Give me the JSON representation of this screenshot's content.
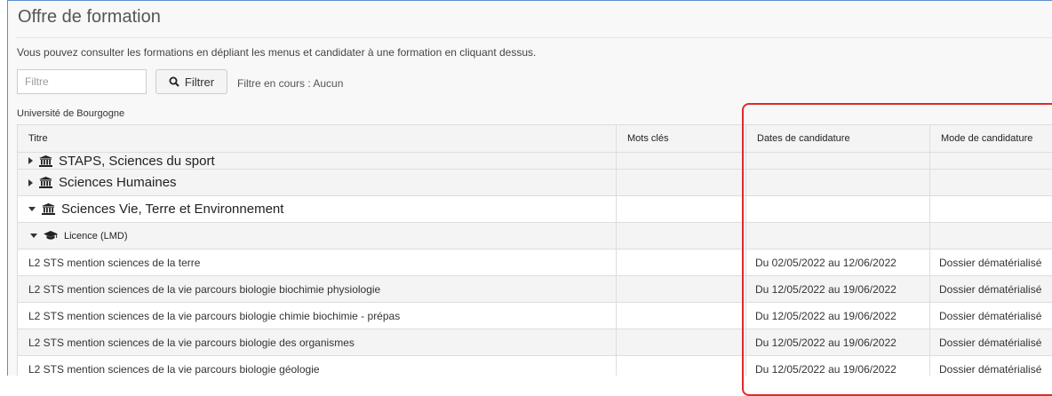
{
  "page": {
    "title": "Offre de formation",
    "intro": "Vous pouvez consulter les formations en dépliant les menus et candidater à une formation en cliquant dessus."
  },
  "filter": {
    "placeholder": "Filtre",
    "value": "",
    "button_label": "Filtrer",
    "button_icon": "search-icon",
    "status": "Filtre en cours : Aucun"
  },
  "table": {
    "caption": "Université de Bourgogne",
    "headers": [
      "Titre",
      "Mots clés",
      "Dates de candidature",
      "Mode de candidature"
    ],
    "categories": [
      {
        "label": "STAPS, Sciences du sport",
        "icon": "institution-icon",
        "expanded": false
      },
      {
        "label": "Sciences Humaines",
        "icon": "institution-icon",
        "expanded": false
      },
      {
        "label": "Sciences Vie, Terre et Environnement",
        "icon": "institution-icon",
        "expanded": true
      }
    ],
    "subcategory": {
      "label": "Licence (LMD)",
      "icon": "graduation-cap-icon",
      "expanded": true
    },
    "rows": [
      {
        "title": "L2 STS mention sciences de la terre",
        "keywords": "",
        "dates": "Du 02/05/2022 au 12/06/2022",
        "mode": "Dossier dématérialisé"
      },
      {
        "title": "L2 STS mention sciences de la vie parcours biologie biochimie physiologie",
        "keywords": "",
        "dates": "Du 12/05/2022 au 19/06/2022",
        "mode": "Dossier dématérialisé"
      },
      {
        "title": "L2 STS mention sciences de la vie parcours biologie chimie biochimie - prépas",
        "keywords": "",
        "dates": "Du 12/05/2022 au 19/06/2022",
        "mode": "Dossier dématérialisé"
      },
      {
        "title": "L2 STS mention sciences de la vie parcours biologie des organismes",
        "keywords": "",
        "dates": "Du 12/05/2022 au 19/06/2022",
        "mode": "Dossier dématérialisé"
      },
      {
        "title": "L2 STS mention sciences de la vie parcours biologie géologie",
        "keywords": "",
        "dates": "Du 12/05/2022 au 19/06/2022",
        "mode": "Dossier dématérialisé"
      }
    ]
  },
  "colors": {
    "highlight": "#e02a2a",
    "frame_border": "#5b8fd1"
  }
}
